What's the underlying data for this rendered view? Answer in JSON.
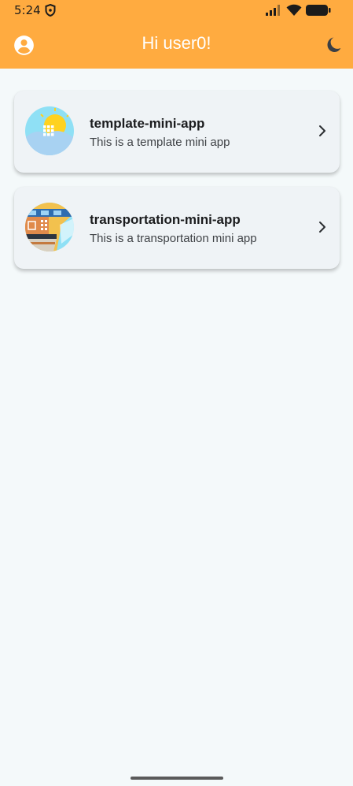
{
  "status_bar": {
    "time": "5:24"
  },
  "app_bar": {
    "title": "Hi user0!",
    "background": "#ffab40",
    "left_icon": "account-circle-icon",
    "right_icon": "dark-mode-moon-icon"
  },
  "mini_apps": [
    {
      "name": "template-mini-app",
      "description": "This is a template mini app",
      "icon": "template-app-thumbnail-icon"
    },
    {
      "name": "transportation-mini-app",
      "description": "This is a transportation mini app",
      "icon": "transportation-app-thumbnail-icon"
    }
  ]
}
